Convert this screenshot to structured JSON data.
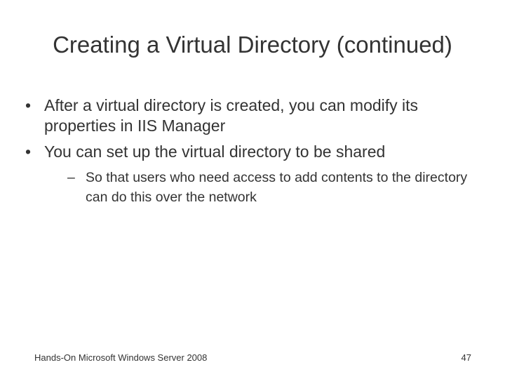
{
  "slide": {
    "title": "Creating a Virtual Directory (continued)",
    "bullet_marker": "•",
    "sub_bullet_marker": "–",
    "bullets": [
      {
        "text": "After a virtual directory is created, you can modify its properties in IIS Manager"
      },
      {
        "text": "You can set up the virtual directory to be shared"
      }
    ],
    "sub_bullets": [
      {
        "text": "So that users who need access to add contents to the directory can do this over the network"
      }
    ],
    "footer": {
      "left": "Hands-On Microsoft Windows Server 2008",
      "page_number": "47"
    }
  },
  "colors": {
    "background": "#ffffff",
    "text": "#333333"
  }
}
